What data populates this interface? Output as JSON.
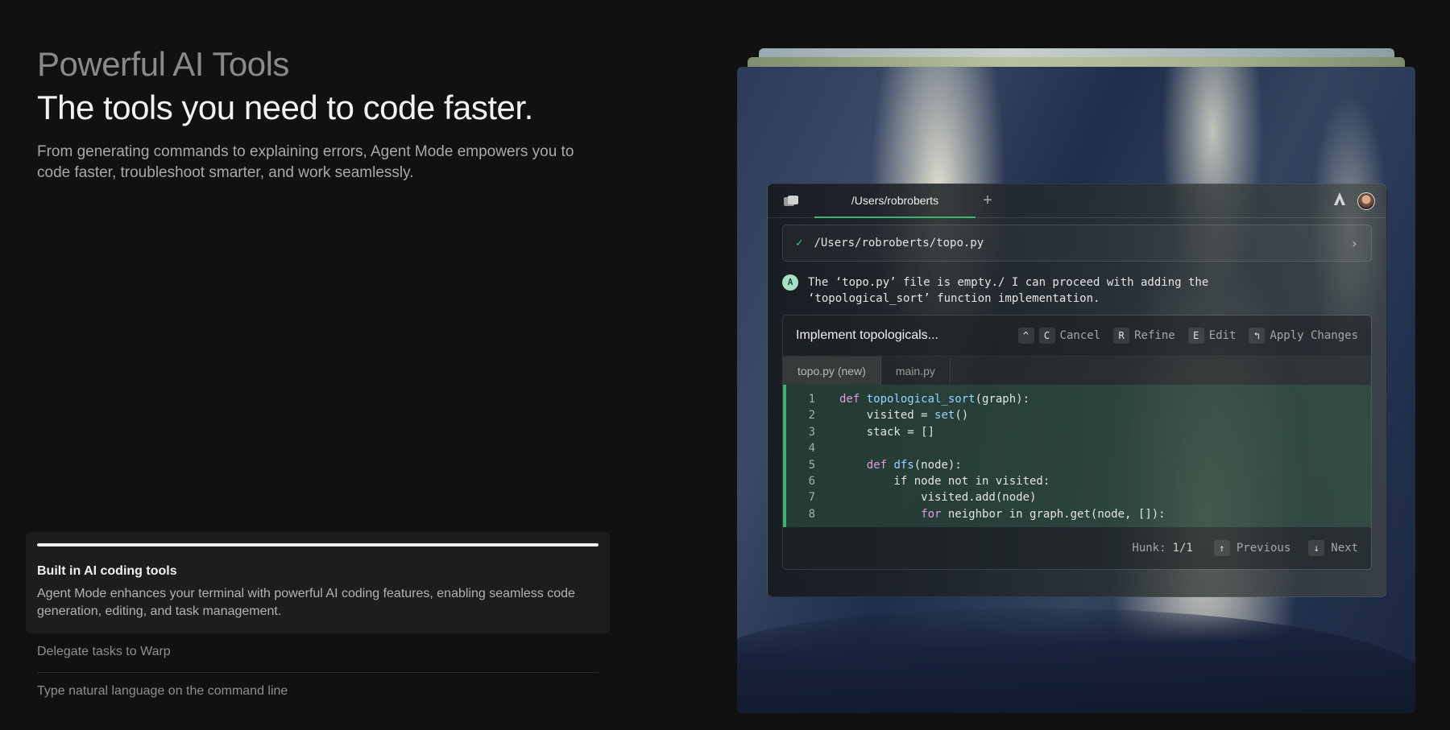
{
  "hero": {
    "eyebrow": "Powerful AI Tools",
    "headline": "The tools you need to code faster.",
    "description": "From generating commands to explaining errors, Agent Mode empowers you to code faster, troubleshoot smarter, and work seamlessly."
  },
  "features": {
    "active": {
      "title": "Built in AI coding tools",
      "description": "Agent Mode enhances your terminal with powerful AI coding features, enabling seamless code generation, editing, and task management.",
      "progress": 1.0
    },
    "items": [
      {
        "label": "Delegate tasks to Warp"
      },
      {
        "label": "Type natural language on the command line"
      }
    ]
  },
  "terminal": {
    "tab_label": "/Users/robroberts",
    "new_tab_glyph": "+",
    "path_bar": "/Users/robroberts/topo.py",
    "ai_badge": "A",
    "ai_message_line1": "The ‘topo.py’ file is empty./ I can proceed with adding the",
    "ai_message_line2": "‘topological_sort’ function implementation.",
    "diff": {
      "title": "Implement topologicals...",
      "actions": [
        {
          "keys": [
            "^",
            "C"
          ],
          "label": "Cancel"
        },
        {
          "keys": [
            "R"
          ],
          "label": "Refine"
        },
        {
          "keys": [
            "E"
          ],
          "label": "Edit"
        },
        {
          "keys": [
            "↰"
          ],
          "label": "Apply Changes"
        }
      ],
      "file_tabs": [
        "topo.py (new)",
        "main.py"
      ],
      "lines": [
        {
          "n": "1",
          "text": "def topological_sort(graph):"
        },
        {
          "n": "2",
          "text": "    visited = set()"
        },
        {
          "n": "3",
          "text": "    stack = []"
        },
        {
          "n": "4",
          "text": ""
        },
        {
          "n": "5",
          "text": "    def dfs(node):"
        },
        {
          "n": "6",
          "text": "        if node not in visited:"
        },
        {
          "n": "7",
          "text": "            visited.add(node)"
        },
        {
          "n": "8",
          "text": "            for neighbor in graph.get(node, []):"
        }
      ],
      "hunk_label": "Hunk:",
      "hunk_value": "1/1",
      "previous_key": "↑",
      "previous_label": "Previous",
      "next_key": "↓",
      "next_label": "Next"
    }
  },
  "colors": {
    "accent_green": "#3bb273",
    "background": "#111111"
  }
}
